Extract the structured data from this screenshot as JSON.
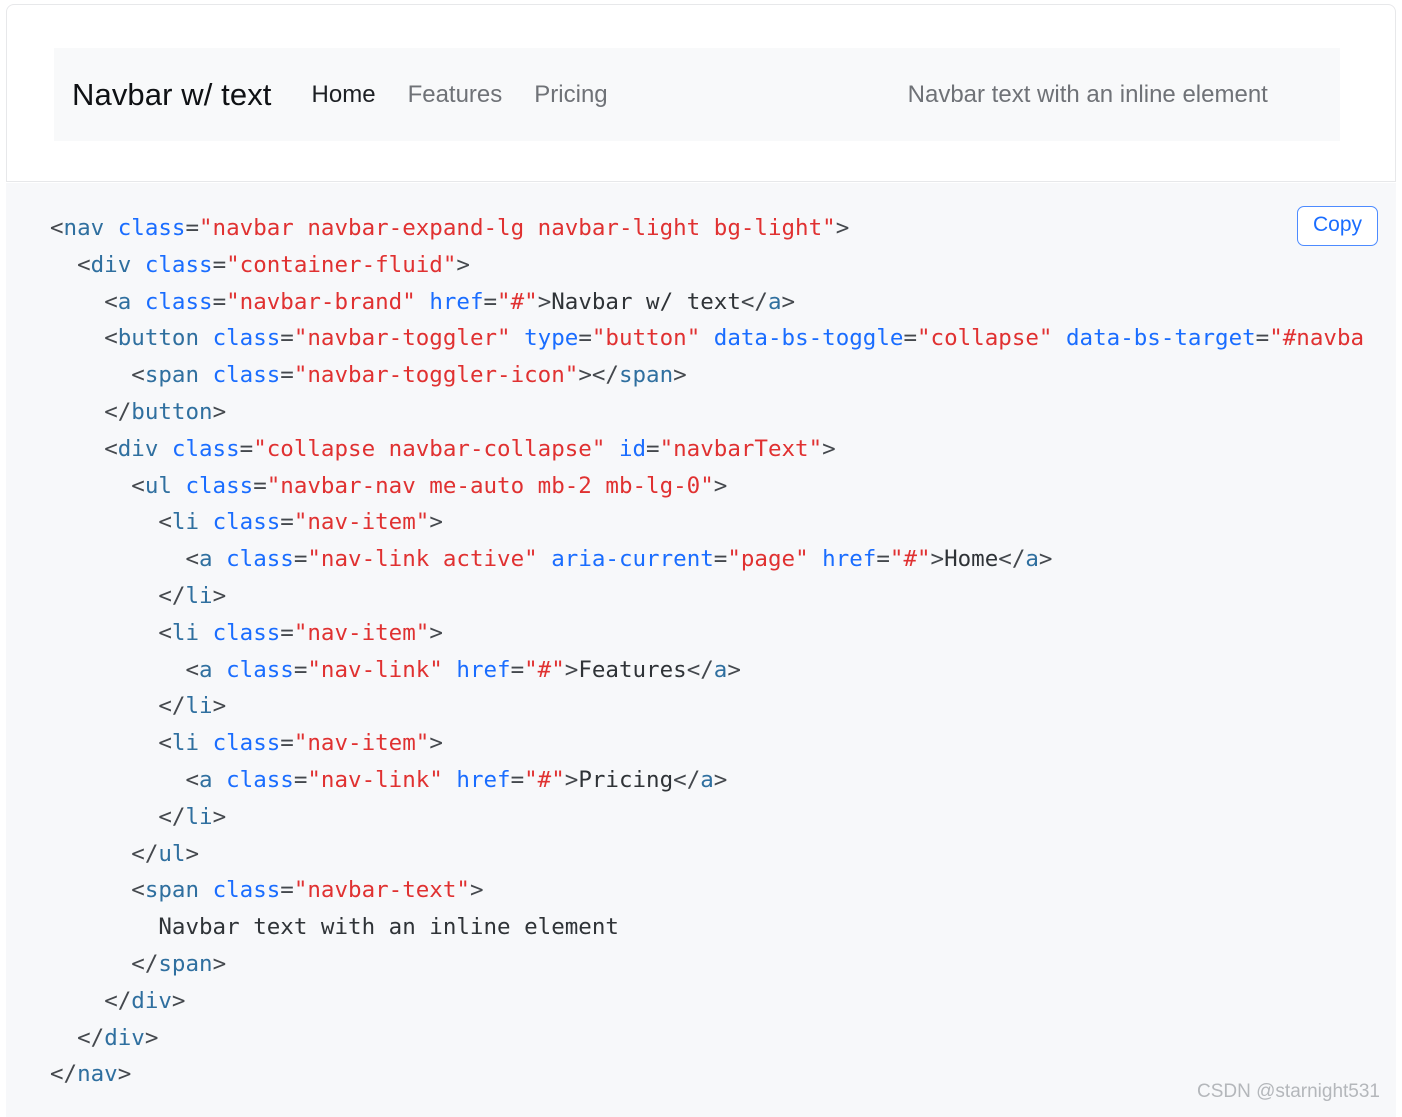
{
  "preview": {
    "navbar": {
      "brand": "Navbar w/ text",
      "links": [
        {
          "label": "Home",
          "active": true
        },
        {
          "label": "Features",
          "active": false
        },
        {
          "label": "Pricing",
          "active": false
        }
      ],
      "text": "Navbar text with an inline element"
    },
    "background_color": "#f8f9fa"
  },
  "code_block": {
    "copy_label": "Copy",
    "language": "html",
    "accent_color": "#1a6dff",
    "background_color": "#f7f8fa",
    "colors": {
      "tag": "#2f6f9f",
      "attribute": "#1a6dff",
      "value": "#e03131",
      "punctuation": "#44484d",
      "text": "#2f3337"
    },
    "lines": [
      {
        "indent": 0,
        "tokens": [
          {
            "t": "punct",
            "v": "<"
          },
          {
            "t": "tag",
            "v": "nav"
          },
          {
            "t": "punct",
            "v": " "
          },
          {
            "t": "attr",
            "v": "class"
          },
          {
            "t": "punct",
            "v": "="
          },
          {
            "t": "val",
            "v": "\"navbar navbar-expand-lg navbar-light bg-light\""
          },
          {
            "t": "punct",
            "v": ">"
          }
        ]
      },
      {
        "indent": 2,
        "tokens": [
          {
            "t": "punct",
            "v": "<"
          },
          {
            "t": "tag",
            "v": "div"
          },
          {
            "t": "punct",
            "v": " "
          },
          {
            "t": "attr",
            "v": "class"
          },
          {
            "t": "punct",
            "v": "="
          },
          {
            "t": "val",
            "v": "\"container-fluid\""
          },
          {
            "t": "punct",
            "v": ">"
          }
        ]
      },
      {
        "indent": 4,
        "tokens": [
          {
            "t": "punct",
            "v": "<"
          },
          {
            "t": "tag",
            "v": "a"
          },
          {
            "t": "punct",
            "v": " "
          },
          {
            "t": "attr",
            "v": "class"
          },
          {
            "t": "punct",
            "v": "="
          },
          {
            "t": "val",
            "v": "\"navbar-brand\""
          },
          {
            "t": "punct",
            "v": " "
          },
          {
            "t": "attr",
            "v": "href"
          },
          {
            "t": "punct",
            "v": "="
          },
          {
            "t": "val",
            "v": "\"#\""
          },
          {
            "t": "punct",
            "v": ">"
          },
          {
            "t": "text",
            "v": "Navbar w/ text"
          },
          {
            "t": "punct",
            "v": "</"
          },
          {
            "t": "tag",
            "v": "a"
          },
          {
            "t": "punct",
            "v": ">"
          }
        ]
      },
      {
        "indent": 4,
        "tokens": [
          {
            "t": "punct",
            "v": "<"
          },
          {
            "t": "tag",
            "v": "button"
          },
          {
            "t": "punct",
            "v": " "
          },
          {
            "t": "attr",
            "v": "class"
          },
          {
            "t": "punct",
            "v": "="
          },
          {
            "t": "val",
            "v": "\"navbar-toggler\""
          },
          {
            "t": "punct",
            "v": " "
          },
          {
            "t": "attr",
            "v": "type"
          },
          {
            "t": "punct",
            "v": "="
          },
          {
            "t": "val",
            "v": "\"button\""
          },
          {
            "t": "punct",
            "v": " "
          },
          {
            "t": "attr",
            "v": "data-bs-toggle"
          },
          {
            "t": "punct",
            "v": "="
          },
          {
            "t": "val",
            "v": "\"collapse\""
          },
          {
            "t": "punct",
            "v": " "
          },
          {
            "t": "attr",
            "v": "data-bs-target"
          },
          {
            "t": "punct",
            "v": "="
          },
          {
            "t": "val",
            "v": "\"#navba"
          }
        ]
      },
      {
        "indent": 6,
        "tokens": [
          {
            "t": "punct",
            "v": "<"
          },
          {
            "t": "tag",
            "v": "span"
          },
          {
            "t": "punct",
            "v": " "
          },
          {
            "t": "attr",
            "v": "class"
          },
          {
            "t": "punct",
            "v": "="
          },
          {
            "t": "val",
            "v": "\"navbar-toggler-icon\""
          },
          {
            "t": "punct",
            "v": ">"
          },
          {
            "t": "punct",
            "v": "</"
          },
          {
            "t": "tag",
            "v": "span"
          },
          {
            "t": "punct",
            "v": ">"
          }
        ]
      },
      {
        "indent": 4,
        "tokens": [
          {
            "t": "punct",
            "v": "</"
          },
          {
            "t": "tag",
            "v": "button"
          },
          {
            "t": "punct",
            "v": ">"
          }
        ]
      },
      {
        "indent": 4,
        "tokens": [
          {
            "t": "punct",
            "v": "<"
          },
          {
            "t": "tag",
            "v": "div"
          },
          {
            "t": "punct",
            "v": " "
          },
          {
            "t": "attr",
            "v": "class"
          },
          {
            "t": "punct",
            "v": "="
          },
          {
            "t": "val",
            "v": "\"collapse navbar-collapse\""
          },
          {
            "t": "punct",
            "v": " "
          },
          {
            "t": "attr",
            "v": "id"
          },
          {
            "t": "punct",
            "v": "="
          },
          {
            "t": "val",
            "v": "\"navbarText\""
          },
          {
            "t": "punct",
            "v": ">"
          }
        ]
      },
      {
        "indent": 6,
        "tokens": [
          {
            "t": "punct",
            "v": "<"
          },
          {
            "t": "tag",
            "v": "ul"
          },
          {
            "t": "punct",
            "v": " "
          },
          {
            "t": "attr",
            "v": "class"
          },
          {
            "t": "punct",
            "v": "="
          },
          {
            "t": "val",
            "v": "\"navbar-nav me-auto mb-2 mb-lg-0\""
          },
          {
            "t": "punct",
            "v": ">"
          }
        ]
      },
      {
        "indent": 8,
        "tokens": [
          {
            "t": "punct",
            "v": "<"
          },
          {
            "t": "tag",
            "v": "li"
          },
          {
            "t": "punct",
            "v": " "
          },
          {
            "t": "attr",
            "v": "class"
          },
          {
            "t": "punct",
            "v": "="
          },
          {
            "t": "val",
            "v": "\"nav-item\""
          },
          {
            "t": "punct",
            "v": ">"
          }
        ]
      },
      {
        "indent": 10,
        "tokens": [
          {
            "t": "punct",
            "v": "<"
          },
          {
            "t": "tag",
            "v": "a"
          },
          {
            "t": "punct",
            "v": " "
          },
          {
            "t": "attr",
            "v": "class"
          },
          {
            "t": "punct",
            "v": "="
          },
          {
            "t": "val",
            "v": "\"nav-link active\""
          },
          {
            "t": "punct",
            "v": " "
          },
          {
            "t": "attr",
            "v": "aria-current"
          },
          {
            "t": "punct",
            "v": "="
          },
          {
            "t": "val",
            "v": "\"page\""
          },
          {
            "t": "punct",
            "v": " "
          },
          {
            "t": "attr",
            "v": "href"
          },
          {
            "t": "punct",
            "v": "="
          },
          {
            "t": "val",
            "v": "\"#\""
          },
          {
            "t": "punct",
            "v": ">"
          },
          {
            "t": "text",
            "v": "Home"
          },
          {
            "t": "punct",
            "v": "</"
          },
          {
            "t": "tag",
            "v": "a"
          },
          {
            "t": "punct",
            "v": ">"
          }
        ]
      },
      {
        "indent": 8,
        "tokens": [
          {
            "t": "punct",
            "v": "</"
          },
          {
            "t": "tag",
            "v": "li"
          },
          {
            "t": "punct",
            "v": ">"
          }
        ]
      },
      {
        "indent": 8,
        "tokens": [
          {
            "t": "punct",
            "v": "<"
          },
          {
            "t": "tag",
            "v": "li"
          },
          {
            "t": "punct",
            "v": " "
          },
          {
            "t": "attr",
            "v": "class"
          },
          {
            "t": "punct",
            "v": "="
          },
          {
            "t": "val",
            "v": "\"nav-item\""
          },
          {
            "t": "punct",
            "v": ">"
          }
        ]
      },
      {
        "indent": 10,
        "tokens": [
          {
            "t": "punct",
            "v": "<"
          },
          {
            "t": "tag",
            "v": "a"
          },
          {
            "t": "punct",
            "v": " "
          },
          {
            "t": "attr",
            "v": "class"
          },
          {
            "t": "punct",
            "v": "="
          },
          {
            "t": "val",
            "v": "\"nav-link\""
          },
          {
            "t": "punct",
            "v": " "
          },
          {
            "t": "attr",
            "v": "href"
          },
          {
            "t": "punct",
            "v": "="
          },
          {
            "t": "val",
            "v": "\"#\""
          },
          {
            "t": "punct",
            "v": ">"
          },
          {
            "t": "text",
            "v": "Features"
          },
          {
            "t": "punct",
            "v": "</"
          },
          {
            "t": "tag",
            "v": "a"
          },
          {
            "t": "punct",
            "v": ">"
          }
        ]
      },
      {
        "indent": 8,
        "tokens": [
          {
            "t": "punct",
            "v": "</"
          },
          {
            "t": "tag",
            "v": "li"
          },
          {
            "t": "punct",
            "v": ">"
          }
        ]
      },
      {
        "indent": 8,
        "tokens": [
          {
            "t": "punct",
            "v": "<"
          },
          {
            "t": "tag",
            "v": "li"
          },
          {
            "t": "punct",
            "v": " "
          },
          {
            "t": "attr",
            "v": "class"
          },
          {
            "t": "punct",
            "v": "="
          },
          {
            "t": "val",
            "v": "\"nav-item\""
          },
          {
            "t": "punct",
            "v": ">"
          }
        ]
      },
      {
        "indent": 10,
        "tokens": [
          {
            "t": "punct",
            "v": "<"
          },
          {
            "t": "tag",
            "v": "a"
          },
          {
            "t": "punct",
            "v": " "
          },
          {
            "t": "attr",
            "v": "class"
          },
          {
            "t": "punct",
            "v": "="
          },
          {
            "t": "val",
            "v": "\"nav-link\""
          },
          {
            "t": "punct",
            "v": " "
          },
          {
            "t": "attr",
            "v": "href"
          },
          {
            "t": "punct",
            "v": "="
          },
          {
            "t": "val",
            "v": "\"#\""
          },
          {
            "t": "punct",
            "v": ">"
          },
          {
            "t": "text",
            "v": "Pricing"
          },
          {
            "t": "punct",
            "v": "</"
          },
          {
            "t": "tag",
            "v": "a"
          },
          {
            "t": "punct",
            "v": ">"
          }
        ]
      },
      {
        "indent": 8,
        "tokens": [
          {
            "t": "punct",
            "v": "</"
          },
          {
            "t": "tag",
            "v": "li"
          },
          {
            "t": "punct",
            "v": ">"
          }
        ]
      },
      {
        "indent": 6,
        "tokens": [
          {
            "t": "punct",
            "v": "</"
          },
          {
            "t": "tag",
            "v": "ul"
          },
          {
            "t": "punct",
            "v": ">"
          }
        ]
      },
      {
        "indent": 6,
        "tokens": [
          {
            "t": "punct",
            "v": "<"
          },
          {
            "t": "tag",
            "v": "span"
          },
          {
            "t": "punct",
            "v": " "
          },
          {
            "t": "attr",
            "v": "class"
          },
          {
            "t": "punct",
            "v": "="
          },
          {
            "t": "val",
            "v": "\"navbar-text\""
          },
          {
            "t": "punct",
            "v": ">"
          }
        ]
      },
      {
        "indent": 8,
        "tokens": [
          {
            "t": "text",
            "v": "Navbar text with an inline element"
          }
        ]
      },
      {
        "indent": 6,
        "tokens": [
          {
            "t": "punct",
            "v": "</"
          },
          {
            "t": "tag",
            "v": "span"
          },
          {
            "t": "punct",
            "v": ">"
          }
        ]
      },
      {
        "indent": 4,
        "tokens": [
          {
            "t": "punct",
            "v": "</"
          },
          {
            "t": "tag",
            "v": "div"
          },
          {
            "t": "punct",
            "v": ">"
          }
        ]
      },
      {
        "indent": 2,
        "tokens": [
          {
            "t": "punct",
            "v": "</"
          },
          {
            "t": "tag",
            "v": "div"
          },
          {
            "t": "punct",
            "v": ">"
          }
        ]
      },
      {
        "indent": 0,
        "tokens": [
          {
            "t": "punct",
            "v": "</"
          },
          {
            "t": "tag",
            "v": "nav"
          },
          {
            "t": "punct",
            "v": ">"
          }
        ]
      }
    ]
  },
  "watermark": "CSDN @starnight531"
}
